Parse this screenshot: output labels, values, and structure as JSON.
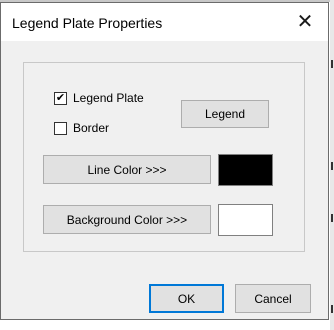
{
  "dialog": {
    "title": "Legend Plate Properties",
    "close_glyph": "✕"
  },
  "options": {
    "legend_plate": {
      "label": "Legend Plate",
      "checked": true
    },
    "border": {
      "label": "Border",
      "checked": false
    }
  },
  "buttons": {
    "legend": "Legend",
    "line_color": "Line Color >>>",
    "background_color": "Background Color >>>",
    "ok": "OK",
    "cancel": "Cancel"
  },
  "colors": {
    "line_color": "#000000",
    "background_color": "#ffffff"
  },
  "icons": {
    "close": "close-icon",
    "check": "check-icon"
  }
}
